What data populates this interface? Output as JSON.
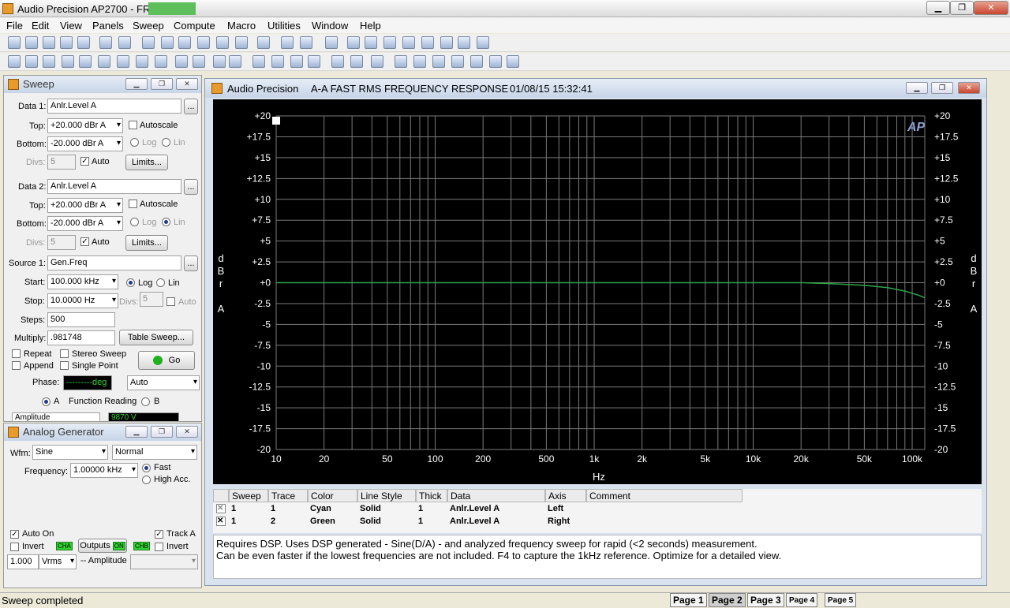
{
  "app": {
    "title": "Audio Precision AP2700 - FR",
    "min": "▁",
    "max": "❐",
    "close": "✕"
  },
  "menu": [
    "File",
    "Edit",
    "View",
    "Panels",
    "Sweep",
    "Compute",
    "Macro",
    "Utilities",
    "Window",
    "Help"
  ],
  "sweep": {
    "title": "Sweep",
    "data1": {
      "label": "Data 1:",
      "value": "Anlr.Level A",
      "top_label": "Top:",
      "top": "+20.000  dBr A",
      "bottom_label": "Bottom:",
      "bottom": "-20.000  dBr A",
      "autoscale": "Autoscale",
      "log": "Log",
      "lin": "Lin",
      "divs_label": "Divs:",
      "divs": "5",
      "auto": "Auto",
      "limits": "Limits..."
    },
    "data2": {
      "label": "Data 2:",
      "value": "Anlr.Level A",
      "top_label": "Top:",
      "top": "+20.000  dBr A",
      "bottom_label": "Bottom:",
      "bottom": "-20.000  dBr A",
      "autoscale": "Autoscale",
      "log": "Log",
      "lin": "Lin",
      "divs_label": "Divs:",
      "divs": "5",
      "auto": "Auto",
      "limits": "Limits..."
    },
    "source1": {
      "label": "Source 1:",
      "value": "Gen.Freq",
      "start_label": "Start:",
      "start": "100.000 kHz",
      "stop_label": "Stop:",
      "stop": "10.0000  Hz",
      "log": "Log",
      "lin": "Lin",
      "divs_label": "Divs:",
      "divs": "5",
      "auto": "Auto",
      "steps_label": "Steps:",
      "steps": "500",
      "multiply_label": "Multiply:",
      "multiply": ".981748",
      "table_sweep": "Table Sweep..."
    },
    "repeat": "Repeat",
    "stereo": "Stereo Sweep",
    "append": "Append",
    "single": "Single Point",
    "go": "Go"
  },
  "analyzer": {
    "phase_label": "Phase:",
    "phase": "---------deg",
    "phase_mode": "Auto",
    "a": "A",
    "function_reading": "Function Reading",
    "b": "B",
    "amplitude": "Amplitude",
    "reading": "9870    V"
  },
  "generator": {
    "title": "Analog Generator",
    "wfm_label": "Wfm:",
    "wfm": "Sine",
    "mode": "Normal",
    "freq_label": "Frequency:",
    "freq": "1.00000 kHz",
    "fast": "Fast",
    "high_acc": "High Acc.",
    "auto_on": "Auto On",
    "track_a": "Track A",
    "invert": "Invert",
    "cha": "CHA",
    "outputs": "Outputs",
    "on": "ON",
    "chb": "CHB",
    "invert2": "Invert",
    "amplitude": "1.000",
    "units": "Vrms",
    "amp_label": "-- Amplitude"
  },
  "graph": {
    "title": "Audio Precision",
    "subtitle": "A-A FAST RMS FREQUENCY RESPONSE",
    "timestamp": "01/08/15 15:32:41",
    "logo": "AP",
    "ylabel_left": [
      "d",
      "B",
      "r",
      "",
      "A"
    ],
    "ylabel_right": [
      "d",
      "B",
      "r",
      "",
      "A"
    ],
    "xlabel": "Hz"
  },
  "chart_data": {
    "type": "line",
    "xscale": "log",
    "xlim": [
      10,
      120000
    ],
    "ylim": [
      -20,
      20
    ],
    "grid": true,
    "x_ticks": [
      {
        "v": 10,
        "l": "10"
      },
      {
        "v": 20,
        "l": "20"
      },
      {
        "v": 50,
        "l": "50"
      },
      {
        "v": 100,
        "l": "100"
      },
      {
        "v": 200,
        "l": "200"
      },
      {
        "v": 500,
        "l": "500"
      },
      {
        "v": 1000,
        "l": "1k"
      },
      {
        "v": 2000,
        "l": "2k"
      },
      {
        "v": 5000,
        "l": "5k"
      },
      {
        "v": 10000,
        "l": "10k"
      },
      {
        "v": 20000,
        "l": "20k"
      },
      {
        "v": 50000,
        "l": "50k"
      },
      {
        "v": 100000,
        "l": "100k"
      }
    ],
    "y_ticks": [
      {
        "v": 20,
        "l": "+20"
      },
      {
        "v": 17.5,
        "l": "+17.5"
      },
      {
        "v": 15,
        "l": "+15"
      },
      {
        "v": 12.5,
        "l": "+12.5"
      },
      {
        "v": 10,
        "l": "+10"
      },
      {
        "v": 7.5,
        "l": "+7.5"
      },
      {
        "v": 5,
        "l": "+5"
      },
      {
        "v": 2.5,
        "l": "+2.5"
      },
      {
        "v": 0,
        "l": "+0"
      },
      {
        "v": -2.5,
        "l": "-2.5"
      },
      {
        "v": -5,
        "l": "-5"
      },
      {
        "v": -7.5,
        "l": "-7.5"
      },
      {
        "v": -10,
        "l": "-10"
      },
      {
        "v": -12.5,
        "l": "-12.5"
      },
      {
        "v": -15,
        "l": "-15"
      },
      {
        "v": -17.5,
        "l": "-17.5"
      },
      {
        "v": -20,
        "l": "-20"
      }
    ],
    "series": [
      {
        "color": "#2ea44a",
        "x": [
          10,
          100,
          1000,
          10000,
          20000,
          30000,
          50000,
          70000,
          90000,
          110000,
          120000
        ],
        "y": [
          0,
          0,
          0,
          0,
          0,
          -0.1,
          -0.3,
          -0.6,
          -1.0,
          -1.5,
          -1.8
        ]
      }
    ]
  },
  "table": {
    "headers": [
      "Sweep",
      "Trace",
      "Color",
      "Line Style",
      "Thick",
      "Data",
      "Axis",
      "Comment"
    ],
    "rows": [
      {
        "check": "✕",
        "sweep": "1",
        "trace": "1",
        "color": "Cyan",
        "style": "Solid",
        "thick": "1",
        "data": "Anlr.Level A",
        "axis": "Left"
      },
      {
        "check": "✕",
        "sweep": "1",
        "trace": "2",
        "color": "Green",
        "style": "Solid",
        "thick": "1",
        "data": "Anlr.Level A",
        "axis": "Right"
      }
    ]
  },
  "description": [
    "Requires DSP.  Uses DSP generated - Sine(D/A) - and analyzed frequency sweep for rapid (<2 seconds) measurement.",
    "Can be even faster if the lowest frequencies are not included. F4 to capture the 1kHz reference. Optimize for a detailed view."
  ],
  "status": "Sweep completed",
  "pages": [
    "Page 1",
    "Page 2",
    "Page 3",
    "Page 4",
    "Page 5"
  ]
}
